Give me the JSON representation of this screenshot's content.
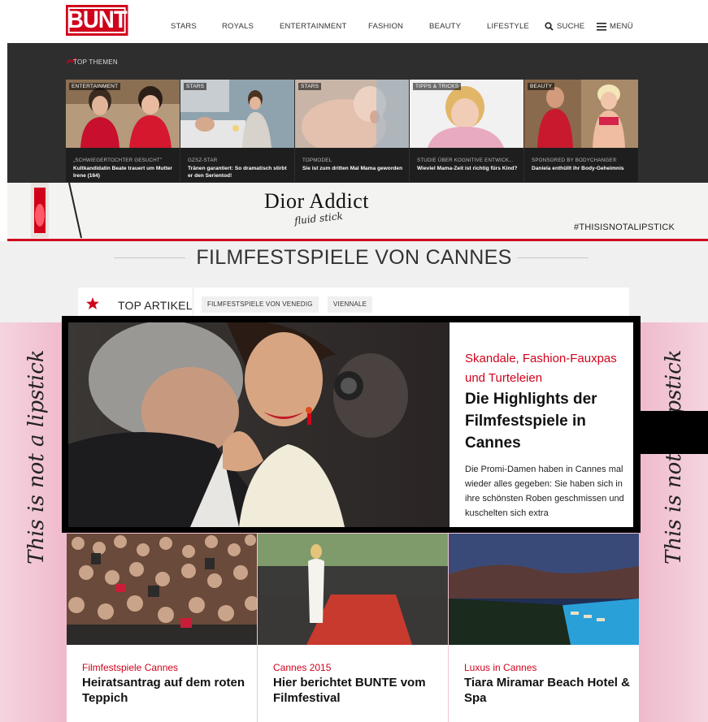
{
  "nav": {
    "logo": "BUNTE",
    "items": [
      "STARS",
      "ROYALS",
      "ENTERTAINMENT",
      "FASHION",
      "BEAUTY",
      "LIFESTYLE"
    ],
    "search_label": "SUCHE",
    "menu_label": "MENÜ",
    "search_icon": "search-icon",
    "menu_icon": "hamburger-menu-icon"
  },
  "top_themen": {
    "title": "TOP THEMEN",
    "icon": "trending-icon",
    "cards": [
      {
        "category": "ENTERTAINMENT",
        "kicker": "„SCHWIEGERTOCHTER GESUCHT\"",
        "headline": "Kultkandidatin Beate trauert um Mutter Irene (164)"
      },
      {
        "category": "STARS",
        "kicker": "GZSZ-STAR",
        "headline": "Tränen garantiert: So dramatisch stirbt er den Serientod!"
      },
      {
        "category": "STARS",
        "kicker": "TOPMODEL",
        "headline": "Sie ist zum dritten Mal Mama geworden"
      },
      {
        "category": "TIPPS & TRICKS",
        "kicker": "STUDIE ÜBER KOGNITIVE ENTWICK...",
        "headline": "Wieviel Mama-Zeit ist richtig fürs Kind?"
      },
      {
        "category": "BEAUTY",
        "kicker": "SPONSORED BY BODYCHANGE®",
        "headline": "Daniela enthüllt ihr Body-Geheimnis"
      }
    ]
  },
  "ad": {
    "brand": "Dior Addict",
    "sub": "fluid stick",
    "hashtag": "#THISISNOTALIPSTICK",
    "side_script": "This is not a lipstick"
  },
  "section": {
    "title": "FILMFESTSPIELE VON CANNES",
    "tab_main": "TOP ARTIKEL",
    "tabs": [
      "FILMFESTSPIELE VON VENEDIG",
      "VIENNALE"
    ]
  },
  "hero": {
    "kicker": "Skandale, Fashion-Fauxpas und Turteleien",
    "title": "Die Highlights der Filmfestspiele in Cannes",
    "teaser": "Die Promi-Damen haben in Cannes mal wieder alles gegeben: Sie haben sich in ihre schönsten Roben geschmissen und kuschelten sich extra"
  },
  "articles": [
    {
      "kicker": "Filmfestspiele Cannes",
      "title": "Heiratsantrag auf dem roten Teppich"
    },
    {
      "kicker": "Cannes 2015",
      "title": "Hier berichtet BUNTE vom Filmfestival"
    },
    {
      "kicker": "Luxus in Cannes",
      "title": "Tiara Miramar Beach Hotel & Spa"
    }
  ],
  "colors": {
    "brand_red": "#d0021b",
    "dark_band": "#2e2e2e",
    "pink_bg": "#f2c6d4"
  }
}
